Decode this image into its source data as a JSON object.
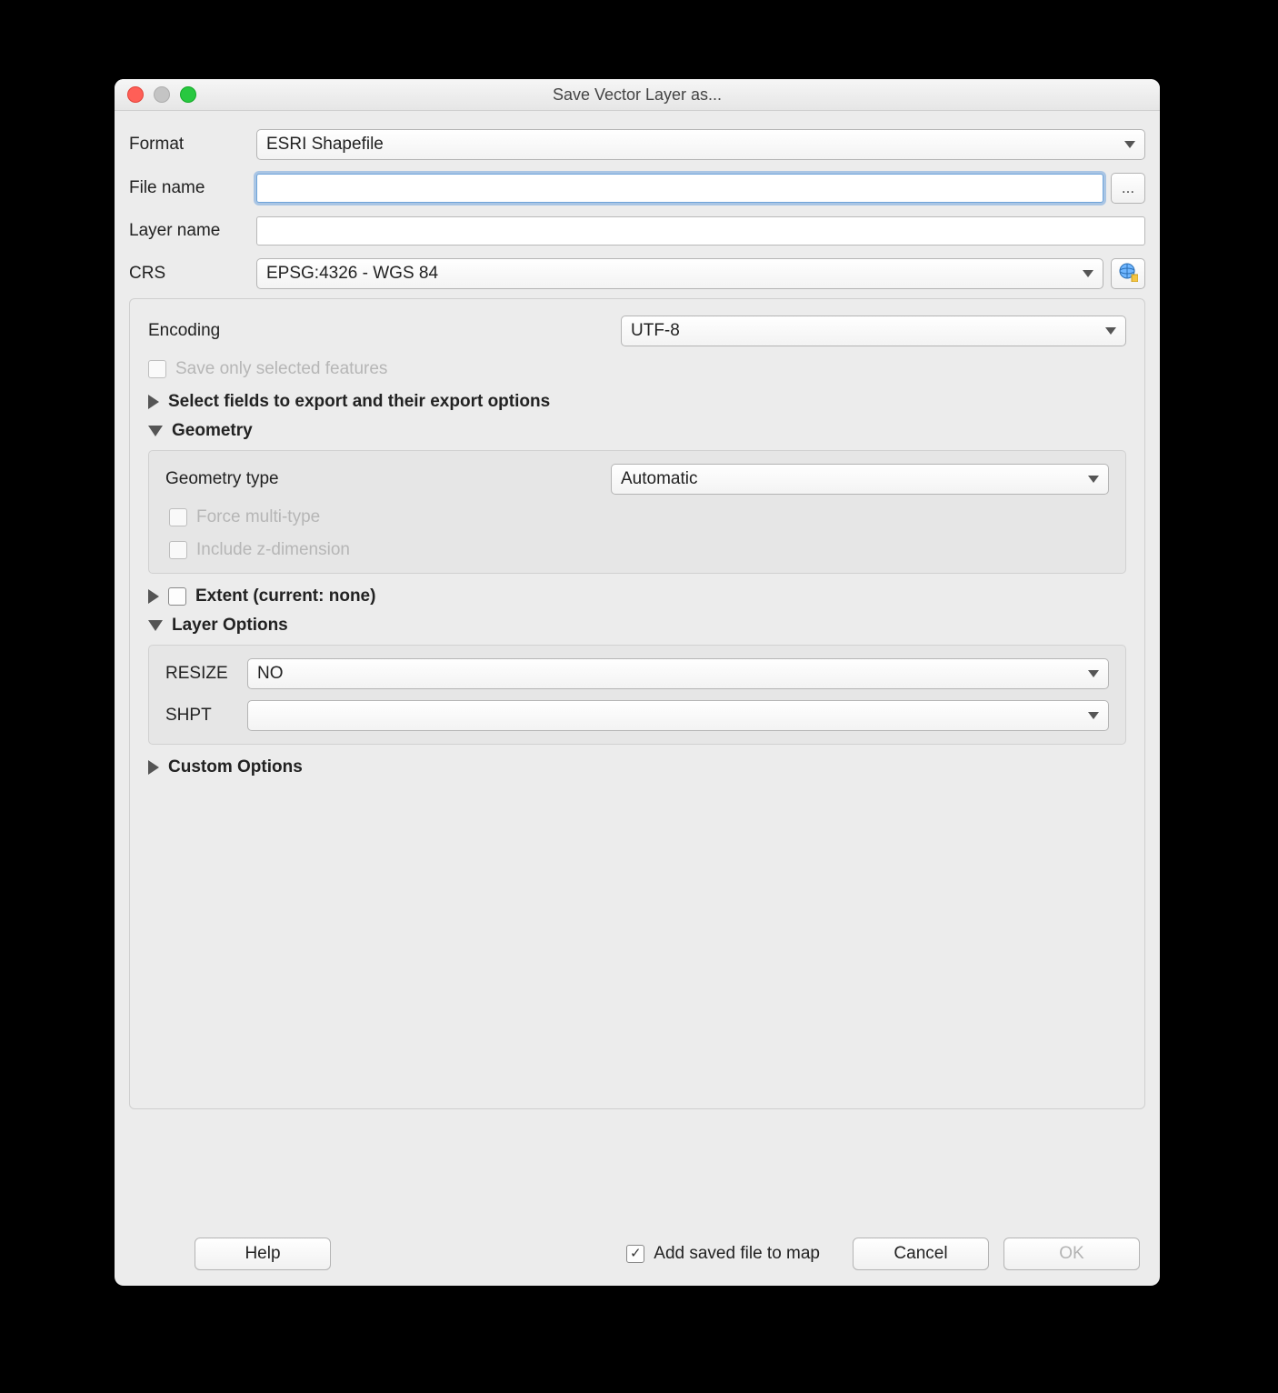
{
  "title": "Save Vector Layer as...",
  "labels": {
    "format": "Format",
    "file_name": "File name",
    "layer_name": "Layer name",
    "crs": "CRS",
    "encoding": "Encoding",
    "save_selected": "Save only selected features",
    "select_fields": "Select fields to export and their export options",
    "geometry": "Geometry",
    "geometry_type": "Geometry type",
    "force_multi": "Force multi-type",
    "include_z": "Include z-dimension",
    "extent": "Extent (current: none)",
    "layer_options": "Layer Options",
    "resize": "RESIZE",
    "shpt": "SHPT",
    "custom_options": "Custom Options",
    "add_to_map": "Add saved file to map",
    "browse": "...",
    "help": "Help",
    "cancel": "Cancel",
    "ok": "OK"
  },
  "values": {
    "format": "ESRI Shapefile",
    "file_name": "",
    "layer_name": "",
    "crs": "EPSG:4326 - WGS 84",
    "encoding": "UTF-8",
    "geometry_type": "Automatic",
    "resize": "NO",
    "shpt": "",
    "add_to_map_checked": true
  }
}
